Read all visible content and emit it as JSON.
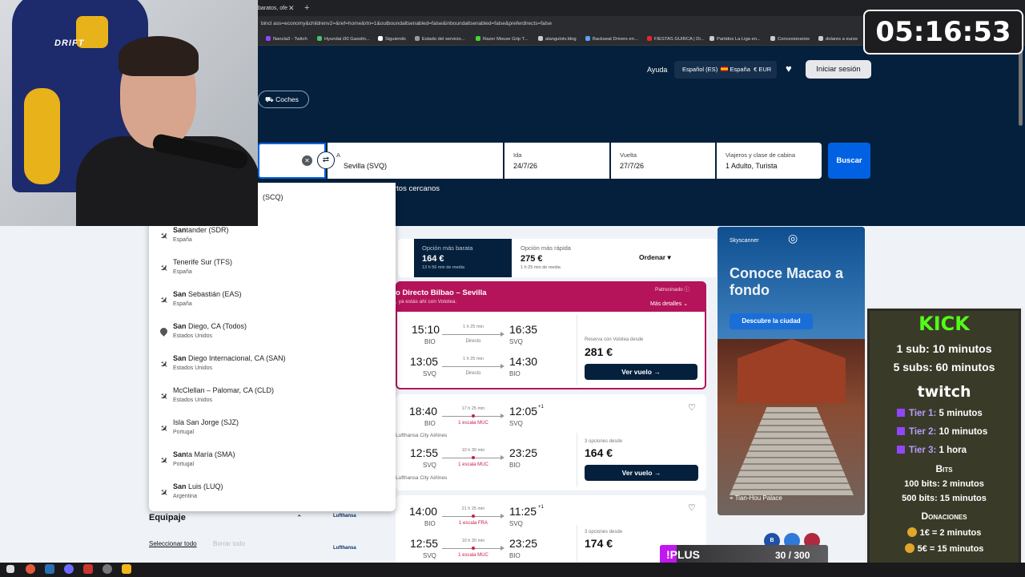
{
  "browser": {
    "tab_title": "baratos, ofe",
    "tab_close": "✕",
    "new_tab": "+",
    "url": "bincl ass=economy&childrenv2=&ref=home&rtn=1&outboundaltsenabled=false&inboundaltsenabled=false&preferdirects=false",
    "bookmarks": [
      "Nancla3 - Twitch",
      "Hyundai i30 Gasolin...",
      "Siguiendo",
      "Estado del servicio...",
      "Razer Mouse Grip T...",
      "alangulotv.blog",
      "Backseat Drivers en...",
      "FIESTAS GUIRCA | Di...",
      "Partidos La Liga en...",
      "Concesionarios",
      "dolares a euros"
    ]
  },
  "header": {
    "help": "Ayuda",
    "locale": "Español (ES)",
    "country": "España",
    "currency": "€ EUR",
    "login": "Iniciar sesión",
    "cars_chip": "Coches"
  },
  "search": {
    "to_label": "A",
    "to_value": "Sevilla (SVQ)",
    "depart_label": "Ida",
    "depart_value": "24/7/26",
    "return_label": "Vuelta",
    "return_value": "27/7/26",
    "travellers_label": "Viajeros y clase de cabina",
    "travellers_value": "1 Adulto, Turista",
    "search_button": "Buscar",
    "nearby": "rtos cercanos"
  },
  "dropdown": {
    "first_partial": "(SCQ)",
    "items": [
      {
        "bold": "San",
        "rest": "tander (SDR)",
        "country": "España",
        "icon": "plane-icon"
      },
      {
        "bold": "",
        "rest": "Tenerife Sur (TFS)",
        "country": "España",
        "icon": "plane-icon"
      },
      {
        "bold": "San",
        "rest": " Sebastián (EAS)",
        "country": "España",
        "icon": "plane-icon"
      },
      {
        "bold": "San",
        "rest": " Diego, CA (Todos)",
        "country": "Estados Unidos",
        "icon": "location-pin-icon"
      },
      {
        "bold": "San",
        "rest": " Diego Internacional, CA (SAN)",
        "country": "Estados Unidos",
        "icon": "plane-icon"
      },
      {
        "bold": "",
        "rest": "McClellan – Palomar, CA (CLD)",
        "country": "Estados Unidos",
        "icon": "plane-icon"
      },
      {
        "bold": "",
        "rest": "Isla San Jorge (SJZ)",
        "country": "Portugal",
        "icon": "plane-icon"
      },
      {
        "bold": "San",
        "rest": "ta María (SMA)",
        "country": "Portugal",
        "icon": "plane-icon"
      },
      {
        "bold": "San",
        "rest": " Luis (LUQ)",
        "country": "Argentina",
        "icon": "plane-icon"
      }
    ]
  },
  "sort": {
    "cheapest_label": "Opción más barata",
    "cheapest_price": "164 €",
    "cheapest_sub": "13 h 56 min de media",
    "fastest_label": "Opción más rápida",
    "fastest_price": "275 €",
    "fastest_sub": "1 h 25 min de media",
    "order": "Ordenar"
  },
  "promo": {
    "title": "o Directo Bilbao – Sevilla",
    "subtitle": ", ya estás ahí con Volotea.",
    "badge": "Patrocinado",
    "more": "Más detalles",
    "out": {
      "dep": "15:10",
      "dep_code": "BIO",
      "dur": "1 h 25 min",
      "stops": "Directo",
      "arr": "16:35",
      "arr_code": "SVQ"
    },
    "ret": {
      "dep": "13:05",
      "dep_code": "SVQ",
      "dur": "1 h 25 min",
      "stops": "Directo",
      "arr": "14:30",
      "arr_code": "BIO"
    },
    "price_label": "Reserva con Volotea desde",
    "price": "281 €",
    "button": "Ver vuelo →"
  },
  "card1": {
    "out": {
      "dep": "18:40",
      "dep_code": "BIO",
      "dur": "17 h 25 min",
      "stops": "1 escala MUC",
      "arr": "12:05",
      "plus": "+1",
      "arr_code": "SVQ"
    },
    "out_airline": "Lufthansa City Airlines",
    "ret": {
      "dep": "12:55",
      "dep_code": "SVQ",
      "dur": "10 h 30 min",
      "stops": "1 escala MUC",
      "arr": "23:25",
      "arr_code": "BIO"
    },
    "ret_airline": "Lufthansa City Airlines",
    "price_label": "3 opciones desde",
    "price": "164 €",
    "button": "Ver vuelo →"
  },
  "card2": {
    "logo": "Lufthansa",
    "out": {
      "dep": "14:00",
      "dep_code": "BIO",
      "dur": "21 h 25 min",
      "stops": "1 escala FRA",
      "arr": "11:25",
      "plus": "+1",
      "arr_code": "SVQ"
    },
    "ret": {
      "dep": "12:55",
      "dep_code": "SVQ",
      "dur": "10 h 30 min",
      "stops": "1 escala MUC",
      "arr": "23:25",
      "arr_code": "BIO"
    },
    "price_label": "3 opciones desde",
    "price": "174 €"
  },
  "ad": {
    "brand": "Skyscanner",
    "title": "Conoce Macao a fondo",
    "button": "Descubre la ciudad",
    "place": "Tian-Hou Palace"
  },
  "filters": {
    "baggage": "Equipaje",
    "select_all": "Seleccionar todo",
    "clear_all": "Borrar todo"
  },
  "stream": {
    "timer": "05:16:53",
    "chair_logo": "DRIFT",
    "kick": "KICK",
    "kick_line1": "1 sub: 10 minutos",
    "kick_line2": "5 subs: 60 minutos",
    "twitch": "twitch",
    "tiers": [
      {
        "name": "Tier 1:",
        "value": "5 minutos"
      },
      {
        "name": "Tier 2:",
        "value": "10 minutos"
      },
      {
        "name": "Tier 3:",
        "value": "1 hora"
      }
    ],
    "bits_title": "Bits",
    "bits1": "100 bits: 2 minutos",
    "bits2": "500 bits: 15 minutos",
    "donations_title": "Donaciones",
    "don1": "1€ = 2 minutos",
    "don2": "5€ = 15 minutos",
    "goal_label": "!PLUS",
    "goal_count": "30 / 300",
    "goal_progress": 0.1
  },
  "colors": {
    "brand_dark": "#05203c",
    "brand_blue": "#0062e3",
    "promo": "#b5145a",
    "kick": "#53fc18",
    "twitch": "#9146ff"
  }
}
